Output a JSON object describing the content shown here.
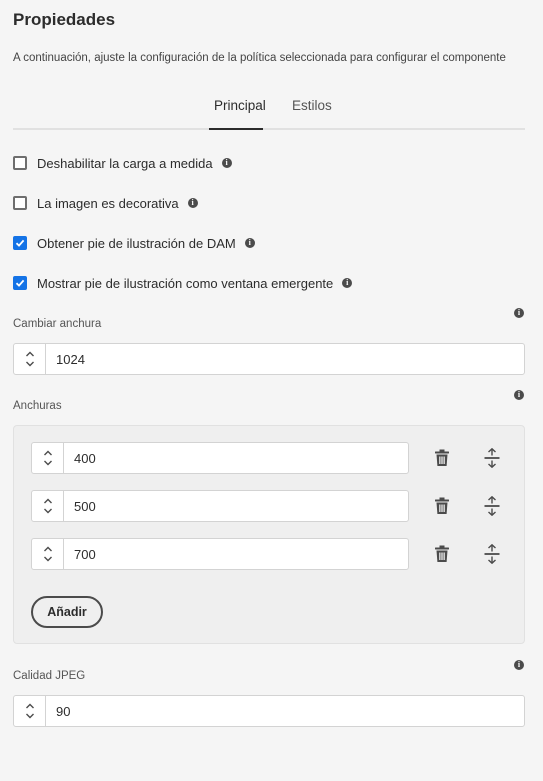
{
  "header": {
    "title": "Propiedades",
    "description": "A continuación, ajuste la configuración de la política seleccionada para configurar el componente"
  },
  "tabs": [
    {
      "label": "Principal",
      "active": true
    },
    {
      "label": "Estilos",
      "active": false
    }
  ],
  "checkboxes": [
    {
      "label": "Deshabilitar la carga a medida",
      "checked": false
    },
    {
      "label": "La imagen es decorativa",
      "checked": false
    },
    {
      "label": "Obtener pie de ilustración de DAM",
      "checked": true
    },
    {
      "label": "Mostrar pie de ilustración como ventana emergente",
      "checked": true
    }
  ],
  "resize_width": {
    "label": "Cambiar anchura",
    "value": "1024"
  },
  "widths": {
    "label": "Anchuras",
    "items": [
      "400",
      "500",
      "700"
    ],
    "add_label": "Añadir"
  },
  "jpeg_quality": {
    "label": "Calidad JPEG",
    "value": "90"
  },
  "icons": {
    "info": "info-icon",
    "delete": "trash-icon",
    "reorder": "drag-handle-icon",
    "stepper": "stepper-icon",
    "check": "checkmark-icon"
  },
  "colors": {
    "accent": "#1473e6",
    "background": "#f5f5f5",
    "text": "#2c2c2c"
  }
}
